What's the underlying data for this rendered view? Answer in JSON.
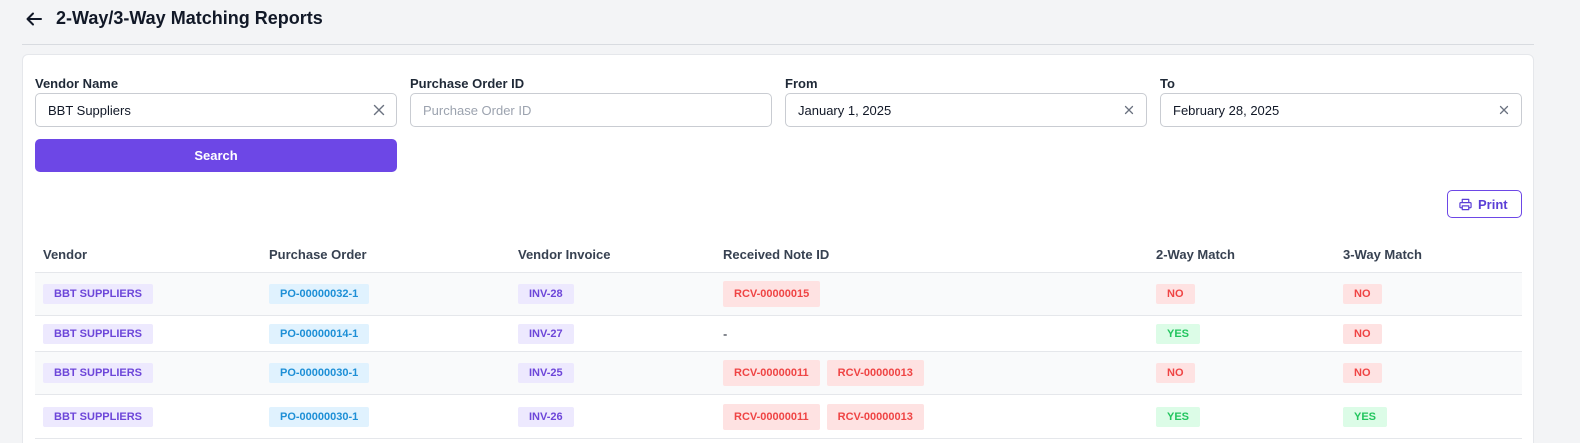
{
  "page": {
    "title": "2-Way/3-Way Matching Reports"
  },
  "filters": {
    "vendor": {
      "label": "Vendor Name",
      "value": "BBT Suppliers"
    },
    "po": {
      "label": "Purchase Order ID",
      "placeholder": "Purchase Order ID"
    },
    "from": {
      "label": "From",
      "value": "January 1, 2025"
    },
    "to": {
      "label": "To",
      "value": "February 28, 2025"
    }
  },
  "search_label": "Search",
  "print_label": "Print",
  "table": {
    "headers": [
      "Vendor",
      "Purchase Order",
      "Vendor Invoice",
      "Received Note ID",
      "2-Way Match",
      "3-Way Match"
    ],
    "rows": [
      {
        "vendor": "BBT SUPPLIERS",
        "po": "PO-00000032-1",
        "invoice": "INV-28",
        "rcv": [
          "RCV-00000015"
        ],
        "two_way": "NO",
        "three_way": "NO"
      },
      {
        "vendor": "BBT SUPPLIERS",
        "po": "PO-00000014-1",
        "invoice": "INV-27",
        "rcv": [
          "-"
        ],
        "two_way": "YES",
        "three_way": "NO"
      },
      {
        "vendor": "BBT SUPPLIERS",
        "po": "PO-00000030-1",
        "invoice": "INV-25",
        "rcv": [
          "RCV-00000011",
          "RCV-00000013"
        ],
        "two_way": "NO",
        "three_way": "NO"
      },
      {
        "vendor": "BBT SUPPLIERS",
        "po": "PO-00000030-1",
        "invoice": "INV-26",
        "rcv": [
          "RCV-00000011",
          "RCV-00000013"
        ],
        "two_way": "YES",
        "three_way": "YES"
      }
    ]
  },
  "colors": {
    "accent": "#6d47e6",
    "yes": "#22c55e",
    "no": "#ef4444",
    "po": "#1d8fd6"
  },
  "icons": {
    "back": "arrow-left-icon",
    "clear": "close-icon",
    "print": "printer-icon"
  }
}
